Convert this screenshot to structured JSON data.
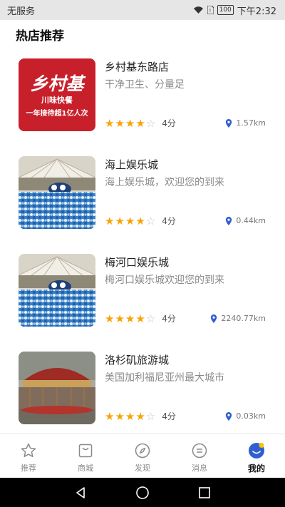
{
  "status_bar": {
    "carrier": "无服务",
    "battery": "100",
    "time": "下午2:32"
  },
  "page_title": "热店推荐",
  "stores": [
    {
      "name": "乡村基东路店",
      "desc": "干净卫生、分量足",
      "rating_text": "4分",
      "distance": "1.57km",
      "rating": 4,
      "logo": {
        "title": "乡村基",
        "sub": "川味快餐",
        "slogan": "一年接待超1亿人次"
      }
    },
    {
      "name": "海上娱乐城",
      "desc": "海上娱乐城，欢迎您的到来",
      "rating_text": "4分",
      "distance": "0.44km",
      "rating": 4
    },
    {
      "name": "梅河口娱乐城",
      "desc": "梅河口娱乐城欢迎您的到来",
      "rating_text": "4分",
      "distance": "2240.77km",
      "rating": 4
    },
    {
      "name": "洛杉矶旅游城",
      "desc": "美国加利福尼亚州最大城市",
      "rating_text": "4分",
      "distance": "0.03km",
      "rating": 4
    }
  ],
  "tabs": [
    {
      "label": "推荐"
    },
    {
      "label": "商城"
    },
    {
      "label": "发现"
    },
    {
      "label": "消息"
    },
    {
      "label": "我的"
    }
  ],
  "colors": {
    "star": "#f7a400",
    "pin": "#2f5fd0",
    "logo_red": "#c8202b"
  }
}
